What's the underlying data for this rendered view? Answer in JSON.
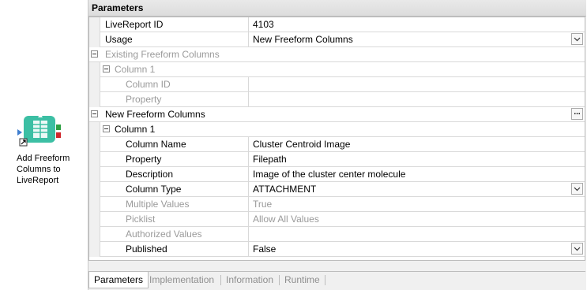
{
  "node": {
    "label_lines": [
      "Add Freeform",
      "Columns to",
      "LiveReport"
    ],
    "icon": "table-add-icon",
    "colors": {
      "body": "#3cbfa4",
      "port_in": "#3f7ecf",
      "port_green": "#2ea043",
      "port_red": "#d0262b"
    }
  },
  "panel": {
    "title": "Parameters",
    "rows": [
      {
        "name": "LiveReport ID",
        "value": "4103"
      },
      {
        "name": "Usage",
        "value": "New Freeform Columns"
      },
      {
        "name": "Existing Freeform Columns",
        "value": ""
      },
      {
        "name": "Column 1",
        "value": ""
      },
      {
        "name": "Column ID",
        "value": ""
      },
      {
        "name": "Property",
        "value": ""
      },
      {
        "name": "New Freeform Columns",
        "value": ""
      },
      {
        "name": "Column 1",
        "value": ""
      },
      {
        "name": "Column Name",
        "value": "Cluster Centroid Image"
      },
      {
        "name": "Property",
        "value": "Filepath"
      },
      {
        "name": "Description",
        "value": "Image of the cluster center molecule"
      },
      {
        "name": "Column Type",
        "value": "ATTACHMENT"
      },
      {
        "name": "Multiple Values",
        "value": "True"
      },
      {
        "name": "Picklist",
        "value": "Allow All Values"
      },
      {
        "name": "Authorized Values",
        "value": ""
      },
      {
        "name": "Published",
        "value": "False"
      }
    ],
    "ellipsis_label": "..."
  },
  "tabs": [
    "Parameters",
    "Implementation",
    "Information",
    "Runtime"
  ],
  "active_tab": "Parameters"
}
